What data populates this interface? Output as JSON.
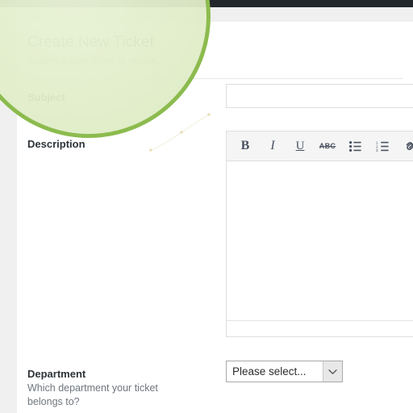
{
  "window": {
    "admin_bar_color": "#23282d",
    "sub_bar_color": "#f0f0f0",
    "page_background": "#ffffff"
  },
  "form": {
    "title": "Create New Ticket",
    "subtitle": "Submit a new ticket to queue.",
    "accent_color": "#8cbb4e",
    "highlight_fill": "#e2eecb"
  },
  "fields": {
    "subject": {
      "label": "Subject",
      "help": "",
      "value": "",
      "placeholder": ""
    },
    "description": {
      "label": "Description",
      "help": "",
      "value": "",
      "toolbar": [
        {
          "name": "bold-icon",
          "glyph": "B"
        },
        {
          "name": "italic-icon",
          "glyph": "I"
        },
        {
          "name": "underline-icon",
          "glyph": "U"
        },
        {
          "name": "strikethrough-icon",
          "glyph": "ABC"
        },
        {
          "name": "unordered-list-icon",
          "glyph": ""
        },
        {
          "name": "ordered-list-icon",
          "glyph": ""
        },
        {
          "name": "link-icon",
          "glyph": ""
        }
      ]
    },
    "department": {
      "label": "Department",
      "help": "Which department your ticket belongs to?",
      "selected": "Please select...",
      "options": [
        "Please select..."
      ]
    }
  }
}
